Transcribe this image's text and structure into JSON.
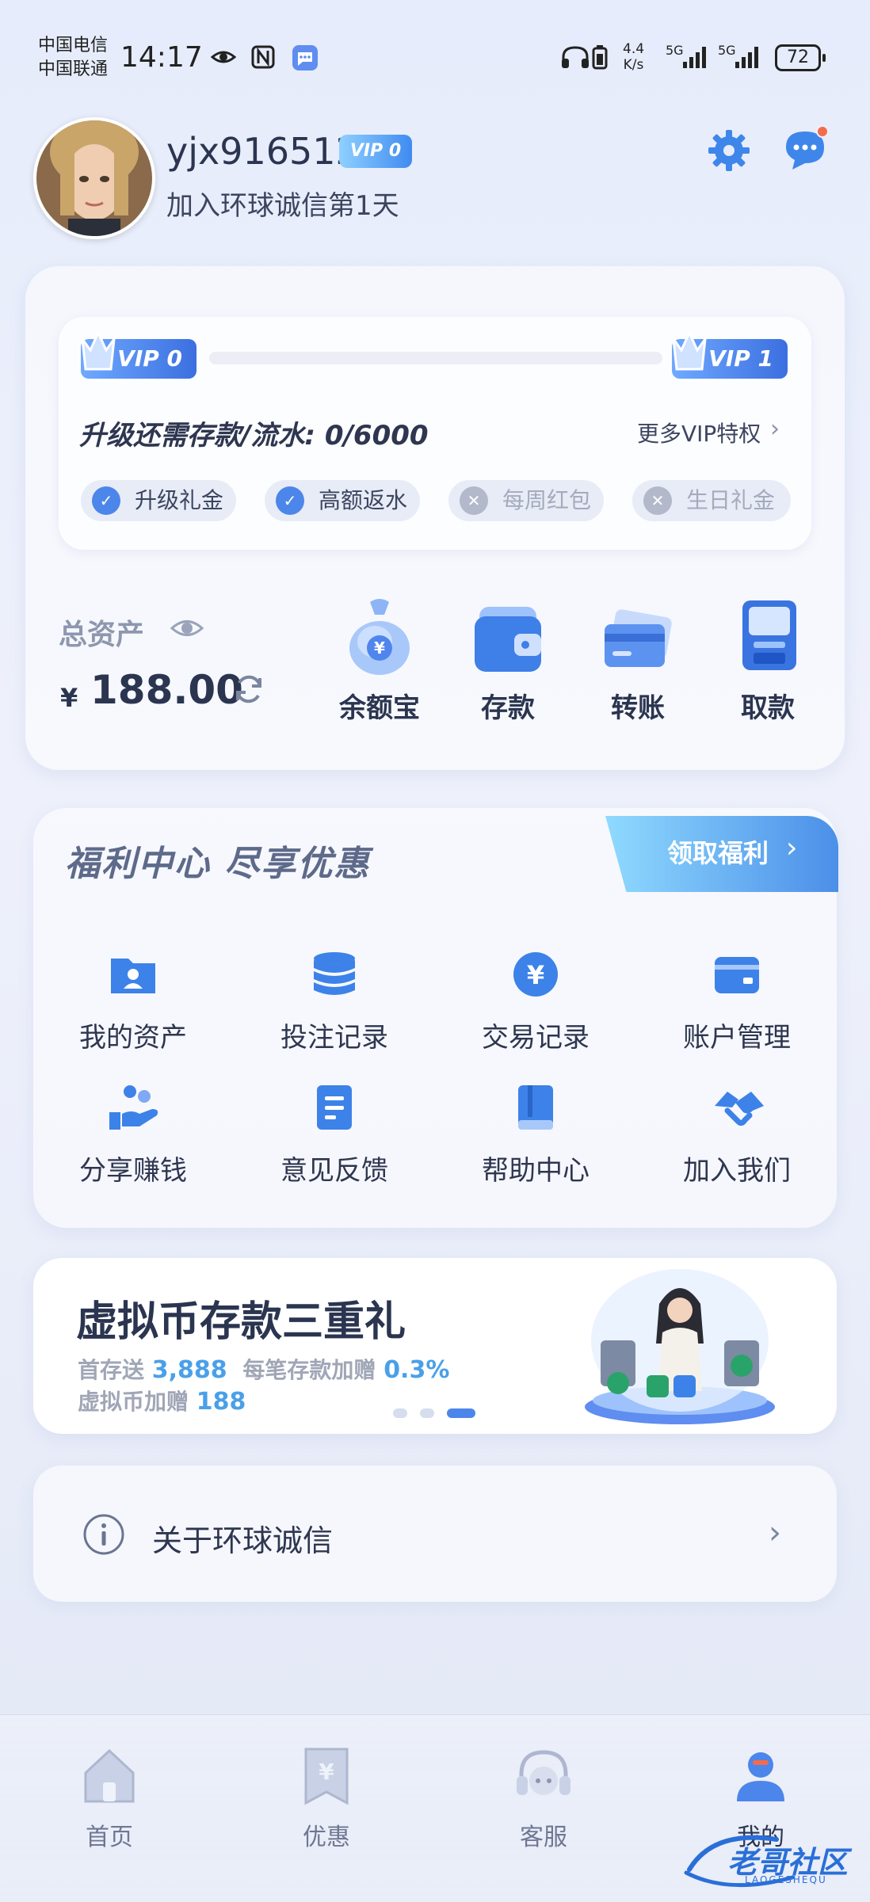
{
  "status_bar": {
    "carrier_1": "中国电信",
    "carrier_2": "中国联通",
    "time": "14:17",
    "net_speed_value": "4.4",
    "net_speed_unit": "K/s",
    "signal_1": "5G",
    "signal_2": "5G",
    "battery": "72",
    "icons": [
      "eye-icon",
      "nfc-icon",
      "chat-app-icon",
      "headphones-icon",
      "phone-battery-icon"
    ]
  },
  "profile": {
    "username": "yjx916512",
    "vip_badge": "VIP 0",
    "join_days": "加入环球诚信第1天"
  },
  "vip_card": {
    "current_level": "VIP 0",
    "next_level": "VIP 1",
    "progress": 0,
    "upgrade_text": "升级还需存款/流水: 0/6000",
    "more_link": "更多VIP特权",
    "perks": [
      {
        "label": "升级礼金",
        "enabled": true
      },
      {
        "label": "高额返水",
        "enabled": true
      },
      {
        "label": "每周红包",
        "enabled": false
      },
      {
        "label": "生日礼金",
        "enabled": false
      }
    ]
  },
  "assets": {
    "total_label": "总资产",
    "currency": "¥",
    "balance": "188.00",
    "actions": [
      {
        "label": "余额宝",
        "icon": "money-bag-icon"
      },
      {
        "label": "存款",
        "icon": "wallet-icon"
      },
      {
        "label": "转账",
        "icon": "transfer-card-icon"
      },
      {
        "label": "取款",
        "icon": "atm-icon"
      }
    ]
  },
  "welfare": {
    "title": "福利中心 尽享优惠",
    "claim_button": "领取福利",
    "grid": [
      {
        "label": "我的资产",
        "icon": "user-folder-icon"
      },
      {
        "label": "投注记录",
        "icon": "database-icon"
      },
      {
        "label": "交易记录",
        "icon": "yuan-coin-icon"
      },
      {
        "label": "账户管理",
        "icon": "wallet-card-icon"
      },
      {
        "label": "分享赚钱",
        "icon": "share-hand-icon"
      },
      {
        "label": "意见反馈",
        "icon": "document-icon"
      },
      {
        "label": "帮助中心",
        "icon": "book-icon"
      },
      {
        "label": "加入我们",
        "icon": "handshake-icon"
      }
    ]
  },
  "banner": {
    "title": "虚拟币存款三重礼",
    "line1_a": "首存送",
    "line1_a_value": "3,888",
    "line1_b": "每笔存款加赠",
    "line1_b_value": "0.3%",
    "line2": "虚拟币加赠",
    "line2_value": "188",
    "active_slide": 3,
    "slide_count": 3
  },
  "about": {
    "label": "关于环球诚信"
  },
  "tabbar": [
    {
      "label": "首页",
      "icon": "home-icon",
      "active": false
    },
    {
      "label": "优惠",
      "icon": "coupon-icon",
      "active": false
    },
    {
      "label": "客服",
      "icon": "headset-icon",
      "active": false
    },
    {
      "label": "我的",
      "icon": "profile-icon",
      "active": true
    }
  ],
  "watermark": {
    "text": "老哥社区",
    "subtext": "LAOGESHEQU"
  },
  "colors": {
    "accent": "#4d86ea",
    "text_primary": "#2b3550",
    "text_muted": "#8e97ae",
    "banner_value": "#4aa0e8"
  }
}
